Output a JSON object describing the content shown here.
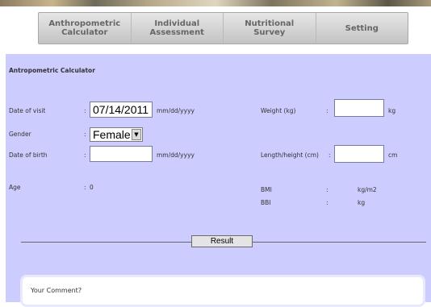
{
  "nav": [
    {
      "label_l1": "Anthropometric",
      "label_l2": "Calculator"
    },
    {
      "label_l1": "Individual",
      "label_l2": "Assessment"
    },
    {
      "label_l1": "Nutritional",
      "label_l2": "Survey"
    },
    {
      "label_l1": "Setting",
      "label_l2": ""
    }
  ],
  "panel_title": "Antropometric Calculator",
  "form": {
    "date_of_visit": {
      "label": "Date of visit",
      "colon": ":",
      "value": "07/14/2011",
      "hint": "mm/dd/yyyy"
    },
    "gender": {
      "label": "Gender",
      "colon": ":",
      "value": "Female"
    },
    "date_of_birth": {
      "label": "Date of birth",
      "colon": ":",
      "value": "",
      "hint": "mm/dd/yyyy"
    },
    "age": {
      "label": "Age",
      "colon": ":",
      "value": "0"
    },
    "weight": {
      "label": "Weight (kg)",
      "colon": ":",
      "value": "",
      "unit": "kg"
    },
    "length": {
      "label": "Length/height (cm)",
      "colon": ":",
      "value": "",
      "unit": "cm"
    },
    "bmi": {
      "label": "BMI",
      "colon": ":",
      "unit": "kg/m2"
    },
    "bbi": {
      "label": "BBI",
      "colon": ":",
      "unit": "kg"
    }
  },
  "result_label": "Result",
  "comment_label": "Your Comment?"
}
